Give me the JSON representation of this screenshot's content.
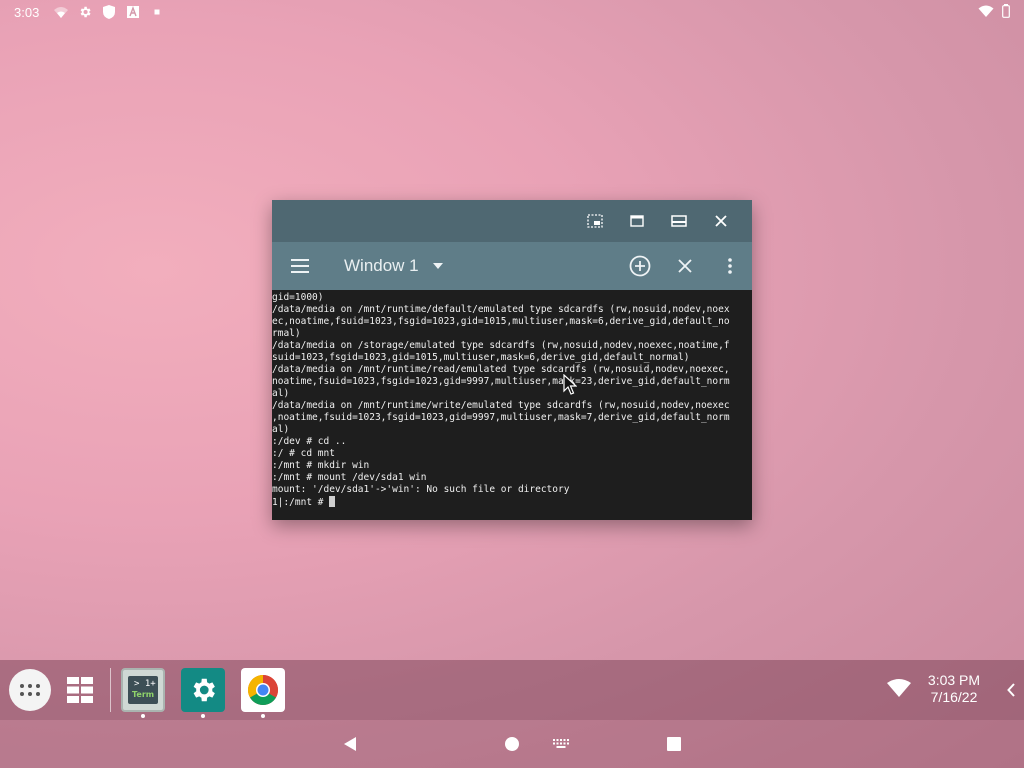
{
  "status_bar": {
    "time": "3:03"
  },
  "window": {
    "title": "Window 1",
    "terminal_lines": [
      "gid=1000)",
      "/data/media on /mnt/runtime/default/emulated type sdcardfs (rw,nosuid,nodev,noex",
      "ec,noatime,fsuid=1023,fsgid=1023,gid=1015,multiuser,mask=6,derive_gid,default_no",
      "rmal)",
      "/data/media on /storage/emulated type sdcardfs (rw,nosuid,nodev,noexec,noatime,f",
      "suid=1023,fsgid=1023,gid=1015,multiuser,mask=6,derive_gid,default_normal)",
      "/data/media on /mnt/runtime/read/emulated type sdcardfs (rw,nosuid,nodev,noexec,",
      "noatime,fsuid=1023,fsgid=1023,gid=9997,multiuser,mask=23,derive_gid,default_norm",
      "al)",
      "/data/media on /mnt/runtime/write/emulated type sdcardfs (rw,nosuid,nodev,noexec",
      ",noatime,fsuid=1023,fsgid=1023,gid=9997,multiuser,mask=7,derive_gid,default_norm",
      "al)",
      ":/dev # cd ..",
      ":/ # cd mnt",
      ":/mnt # mkdir win",
      ":/mnt # mount /dev/sda1 win",
      "mount: '/dev/sda1'->'win': No such file or directory"
    ],
    "prompt": "1|:/mnt # "
  },
  "taskbar": {
    "term_icon_line1": "> 1+",
    "term_icon_line2": "Term",
    "clock_time": "3:03 PM",
    "clock_date": "7/16/22"
  },
  "colors": {
    "caption_bar": "#4f6872",
    "toolbar": "#5f7d88",
    "terminal_bg": "#1e1e1e",
    "terminal_fg": "#f0f0f0"
  }
}
